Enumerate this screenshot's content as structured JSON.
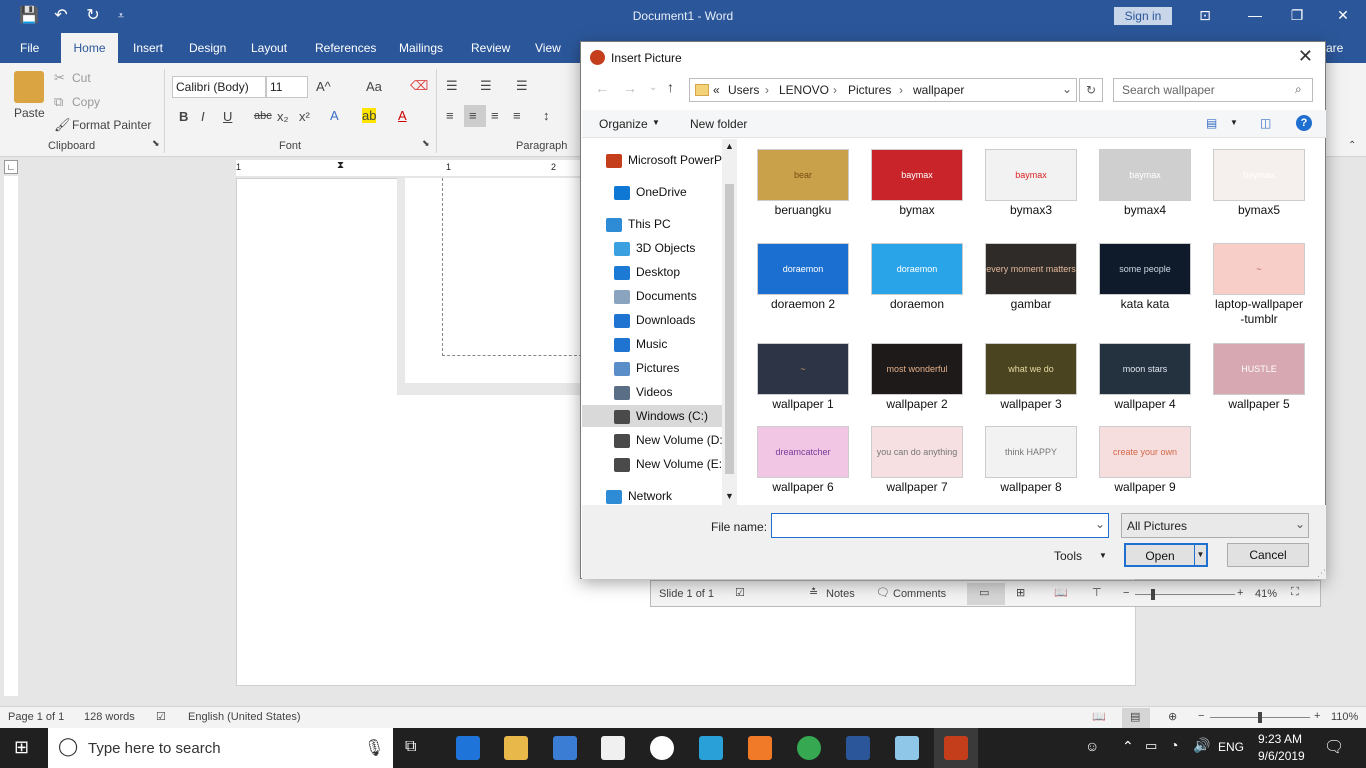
{
  "word": {
    "title": "Document1 - Word",
    "sign_in": "Sign in",
    "tabs": [
      "File",
      "Home",
      "Insert",
      "Design",
      "Layout",
      "References",
      "Mailings",
      "Review",
      "View"
    ],
    "tab_hidden_tail": "are",
    "clipboard": {
      "paste": "Paste",
      "cut": "Cut",
      "copy": "Copy",
      "format_painter": "Format Painter",
      "group": "Clipboard"
    },
    "font": {
      "family": "Calibri (Body)",
      "size": "11",
      "group": "Font"
    },
    "paragraph": {
      "group": "Paragraph"
    },
    "ruler_marks": [
      "1",
      "1",
      "2"
    ],
    "status": {
      "page": "Page 1 of 1",
      "words": "128 words",
      "language": "English (United States)",
      "zoom": "110%"
    }
  },
  "ppt_status": {
    "slide": "Slide 1 of 1",
    "notes": "Notes",
    "comments": "Comments",
    "zoom": "41%"
  },
  "dialog": {
    "title": "Insert Picture",
    "breadcrumb": [
      "«",
      "Users",
      "LENOVO",
      "Pictures",
      "wallpaper"
    ],
    "search_placeholder": "Search wallpaper",
    "organize": "Organize",
    "new_folder": "New folder",
    "nav": [
      {
        "label": "Microsoft PowerP",
        "icon": "powerpoint-icon",
        "color": "#c43e1c"
      },
      {
        "label": "OneDrive",
        "icon": "cloud-icon",
        "color": "#0f78d4"
      },
      {
        "label": "This PC",
        "icon": "computer-icon",
        "color": "#2e8bd6"
      },
      {
        "label": "3D Objects",
        "icon": "cube-icon",
        "color": "#3aa0e0"
      },
      {
        "label": "Desktop",
        "icon": "desktop-icon",
        "color": "#1d7ad4"
      },
      {
        "label": "Documents",
        "icon": "documents-icon",
        "color": "#8aa4c0"
      },
      {
        "label": "Downloads",
        "icon": "download-arrow-icon",
        "color": "#1f74d2"
      },
      {
        "label": "Music",
        "icon": "music-note-icon",
        "color": "#1f74d2"
      },
      {
        "label": "Pictures",
        "icon": "pictures-icon",
        "color": "#5a8ec8"
      },
      {
        "label": "Videos",
        "icon": "videos-icon",
        "color": "#5a6f85"
      },
      {
        "label": "Windows (C:)",
        "icon": "drive-icon",
        "color": "#4a4a4a"
      },
      {
        "label": "New Volume (D:",
        "icon": "drive-icon",
        "color": "#4a4a4a"
      },
      {
        "label": "New Volume (E:)",
        "icon": "drive-icon",
        "color": "#4a4a4a"
      },
      {
        "label": "Network",
        "icon": "network-icon",
        "color": "#2e8bd6"
      }
    ],
    "nav_selected": 10,
    "files": [
      {
        "name": "beruangku",
        "bg": "#c9a14a",
        "fg": "#7a4a10",
        "mark": "bear"
      },
      {
        "name": "bymax",
        "bg": "#c8242a",
        "fg": "#ffffff",
        "mark": "baymax"
      },
      {
        "name": "bymax3",
        "bg": "#f2f2f2",
        "fg": "#d22",
        "mark": "baymax"
      },
      {
        "name": "bymax4",
        "bg": "#cfcfcf",
        "fg": "#ffffff",
        "mark": "baymax"
      },
      {
        "name": "bymax5",
        "bg": "#f5efed",
        "fg": "#ffffff",
        "mark": "baymax"
      },
      {
        "name": "doraemon 2",
        "bg": "#1a6fd1",
        "fg": "#ffffff",
        "mark": "doraemon"
      },
      {
        "name": "doraemon",
        "bg": "#2aa4e8",
        "fg": "#ffffff",
        "mark": "doraemon"
      },
      {
        "name": "gambar",
        "bg": "#2e2b29",
        "fg": "#e5b89a",
        "mark": "every moment matters"
      },
      {
        "name": "kata kata",
        "bg": "#0f1a2a",
        "fg": "#cfd8e4",
        "mark": "some people"
      },
      {
        "name": "laptop-wallpaper\n-tumblr",
        "bg": "#f7cfc8",
        "fg": "#a56",
        "mark": "~"
      },
      {
        "name": "wallpaper 1",
        "bg": "#2c3445",
        "fg": "#c9a46a",
        "mark": "~"
      },
      {
        "name": "wallpaper 2",
        "bg": "#1f1a1a",
        "fg": "#e2b08a",
        "mark": "most wonderful"
      },
      {
        "name": "wallpaper 3",
        "bg": "#4a4420",
        "fg": "#e8d8a0",
        "mark": "what we do"
      },
      {
        "name": "wallpaper 4",
        "bg": "#243240",
        "fg": "#e0e6ee",
        "mark": "moon stars"
      },
      {
        "name": "wallpaper 5",
        "bg": "#d8a8b2",
        "fg": "#fff",
        "mark": "HUSTLE"
      },
      {
        "name": "wallpaper 6",
        "bg": "#f0c6e4",
        "fg": "#7a3a9a",
        "mark": "dreamcatcher"
      },
      {
        "name": "wallpaper 7",
        "bg": "#f6e0e2",
        "fg": "#777",
        "mark": "you can do anything"
      },
      {
        "name": "wallpaper 8",
        "bg": "#f2f2f2",
        "fg": "#777",
        "mark": "think HAPPY"
      },
      {
        "name": "wallpaper 9",
        "bg": "#f6dede",
        "fg": "#d46a4a",
        "mark": "create your own"
      }
    ],
    "file_name_label": "File name:",
    "file_name_value": "",
    "filter": "All Pictures",
    "tools": "Tools",
    "open": "Open",
    "cancel": "Cancel"
  },
  "taskbar": {
    "search": "Type here to search",
    "lang": "ENG",
    "time": "9:23 AM",
    "date": "9/6/2019"
  }
}
